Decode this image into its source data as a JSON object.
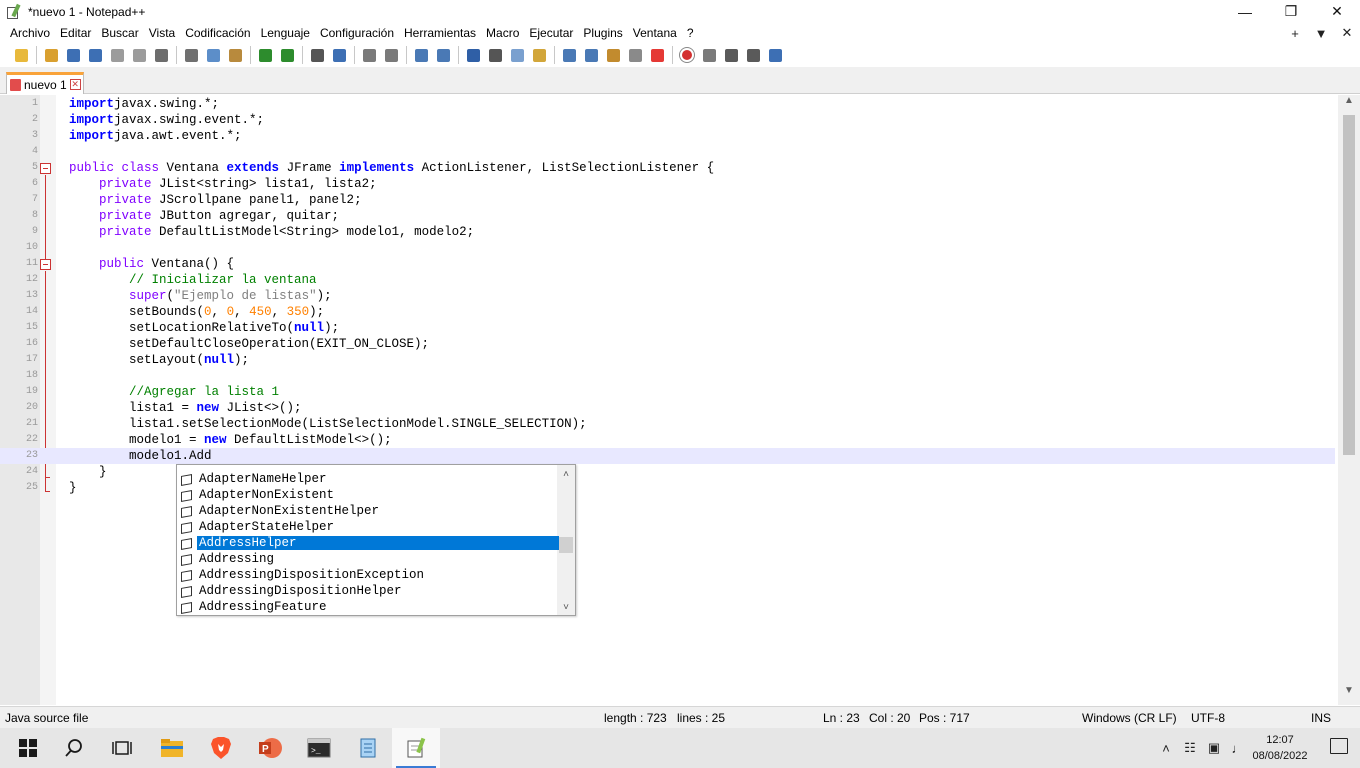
{
  "window": {
    "title": "*nuevo 1 - Notepad++",
    "minimize": "—",
    "maximize": "❐",
    "close": "✕"
  },
  "menu": [
    "Archivo",
    "Editar",
    "Buscar",
    "Vista",
    "Codificación",
    "Lenguaje",
    "Configuración",
    "Herramientas",
    "Macro",
    "Ejecutar",
    "Plugins",
    "Ventana",
    "?"
  ],
  "menu_right": [
    "+",
    "▼",
    "✕"
  ],
  "toolbar_icons": [
    "new-file-icon",
    "open-file-icon",
    "save-icon",
    "save-all-icon",
    "close-icon",
    "close-all-icon",
    "print-icon",
    "cut-icon",
    "copy-icon",
    "paste-icon",
    "undo-icon",
    "redo-icon",
    "find-icon",
    "replace-icon",
    "zoom-in-icon",
    "zoom-out-icon",
    "sync-vertical-icon",
    "sync-horizontal-icon",
    "word-wrap-icon",
    "show-all-chars-icon",
    "indent-guide-icon",
    "udl-icon",
    "doc-map-icon",
    "function-list-icon",
    "folder-workspace-icon",
    "doc-switcher-icon",
    "monitoring-icon",
    "record-macro-icon",
    "stop-macro-icon",
    "play-macro-icon",
    "run-macro-multiple-icon",
    "save-macro-icon"
  ],
  "tab": {
    "label": "nuevo 1",
    "close": "✕"
  },
  "editor": {
    "lines": [
      {
        "n": "1",
        "tokens": [
          [
            "kw",
            "import"
          ],
          [
            "",
            "javax.swing.*;"
          ]
        ]
      },
      {
        "n": "2",
        "tokens": [
          [
            "kw",
            "import"
          ],
          [
            "",
            "javax.swing.event.*;"
          ]
        ]
      },
      {
        "n": "3",
        "tokens": [
          [
            "kw",
            "import"
          ],
          [
            "",
            "java.awt.event.*;"
          ]
        ]
      },
      {
        "n": "4",
        "tokens": []
      },
      {
        "n": "5",
        "tokens": [
          [
            "kt",
            "public class "
          ],
          [
            "",
            "Ventana "
          ],
          [
            "kw",
            "extends"
          ],
          [
            "",
            " JFrame "
          ],
          [
            "kw",
            "implements"
          ],
          [
            "",
            " ActionListener, ListSelectionListener {"
          ]
        ]
      },
      {
        "n": "6",
        "tokens": [
          [
            "",
            "    "
          ],
          [
            "kt",
            "private "
          ],
          [
            "",
            "JList<string> lista1, lista2;"
          ]
        ]
      },
      {
        "n": "7",
        "tokens": [
          [
            "",
            "    "
          ],
          [
            "kt",
            "private "
          ],
          [
            "",
            "JScrollpane panel1, panel2;"
          ]
        ]
      },
      {
        "n": "8",
        "tokens": [
          [
            "",
            "    "
          ],
          [
            "kt",
            "private "
          ],
          [
            "",
            "JButton agregar, quitar;"
          ]
        ]
      },
      {
        "n": "9",
        "tokens": [
          [
            "",
            "    "
          ],
          [
            "kt",
            "private "
          ],
          [
            "",
            "DefaultListModel<String> modelo1, modelo2;"
          ]
        ]
      },
      {
        "n": "10",
        "tokens": []
      },
      {
        "n": "11",
        "tokens": [
          [
            "",
            "    "
          ],
          [
            "kt",
            "public "
          ],
          [
            "",
            "Ventana() {"
          ]
        ]
      },
      {
        "n": "12",
        "tokens": [
          [
            "",
            "        "
          ],
          [
            "cm",
            "// Inicializar la ventana"
          ]
        ]
      },
      {
        "n": "13",
        "tokens": [
          [
            "",
            "        "
          ],
          [
            "kt",
            "super"
          ],
          [
            "",
            "("
          ],
          [
            "st",
            "\"Ejemplo de listas\""
          ],
          [
            "",
            ");"
          ]
        ]
      },
      {
        "n": "14",
        "tokens": [
          [
            "",
            "        setBounds("
          ],
          [
            "nm",
            "0"
          ],
          [
            ", ",
            ""
          ],
          [
            "",
            ", "
          ],
          [
            "nm",
            "0"
          ],
          [
            "",
            ", "
          ],
          [
            "nm",
            "450"
          ],
          [
            "",
            ", "
          ],
          [
            "nm",
            "350"
          ],
          [
            "",
            ");"
          ]
        ]
      },
      {
        "n": "15",
        "tokens": [
          [
            "",
            "        setLocationRelativeTo("
          ],
          [
            "kw",
            "null"
          ],
          [
            "",
            ");"
          ]
        ]
      },
      {
        "n": "16",
        "tokens": [
          [
            "",
            "        setDefaultCloseOperation(EXIT_ON_CLOSE);"
          ]
        ]
      },
      {
        "n": "17",
        "tokens": [
          [
            "",
            "        setLayout("
          ],
          [
            "kw",
            "null"
          ],
          [
            "",
            ");"
          ]
        ]
      },
      {
        "n": "18",
        "tokens": []
      },
      {
        "n": "19",
        "tokens": [
          [
            "",
            "        "
          ],
          [
            "cm",
            "//Agregar la lista 1"
          ]
        ]
      },
      {
        "n": "20",
        "tokens": [
          [
            "",
            "        lista1 = "
          ],
          [
            "kw",
            "new"
          ],
          [
            "",
            " JList<>();"
          ]
        ]
      },
      {
        "n": "21",
        "tokens": [
          [
            "",
            "        lista1.setSelectionMode(ListSelectionModel.SINGLE_SELECTION);"
          ]
        ]
      },
      {
        "n": "22",
        "tokens": [
          [
            "",
            "        modelo1 = "
          ],
          [
            "kw",
            "new"
          ],
          [
            "",
            " DefaultListModel<>();"
          ]
        ]
      },
      {
        "n": "23",
        "tokens": [
          [
            "",
            "        modelo1.Add"
          ]
        ]
      },
      {
        "n": "24",
        "tokens": [
          [
            "",
            "    }"
          ]
        ]
      },
      {
        "n": "25",
        "tokens": [
          [
            "",
            "}"
          ]
        ]
      }
    ],
    "current_line": 23
  },
  "autocomplete": {
    "items": [
      "AdapterNameHelper",
      "AdapterNonExistent",
      "AdapterNonExistentHelper",
      "AdapterStateHelper",
      "AddressHelper",
      "Addressing",
      "AddressingDispositionException",
      "AddressingDispositionHelper",
      "AddressingFeature"
    ],
    "selected_index": 4,
    "scroll_up": "˄",
    "scroll_down": "˅"
  },
  "status": {
    "language": "Java source file",
    "length": "length : 723",
    "lines": "lines : 25",
    "ln": "Ln : 23",
    "col": "Col : 20",
    "pos": "Pos : 717",
    "eol": "Windows (CR LF)",
    "encoding": "UTF-8",
    "mode": "INS"
  },
  "taskbar": {
    "apps": [
      {
        "name": "start-button",
        "color": "#1a1a1a"
      },
      {
        "name": "search-button",
        "color": "#1a1a1a"
      },
      {
        "name": "task-view-button",
        "color": "#1a1a1a"
      },
      {
        "name": "file-explorer-app",
        "color": "#f0b429"
      },
      {
        "name": "brave-browser-app",
        "color": "#fb542b"
      },
      {
        "name": "powerpoint-app",
        "color": "#d04423"
      },
      {
        "name": "terminal-app",
        "color": "#2b2b2b"
      },
      {
        "name": "notepad-app",
        "color": "#5aa0d8"
      },
      {
        "name": "notepadpp-app",
        "color": "#8bc34a"
      }
    ],
    "tray": [
      "˄",
      "☷",
      "▣",
      "♩"
    ],
    "time": "12:07",
    "date": "08/08/2022"
  }
}
